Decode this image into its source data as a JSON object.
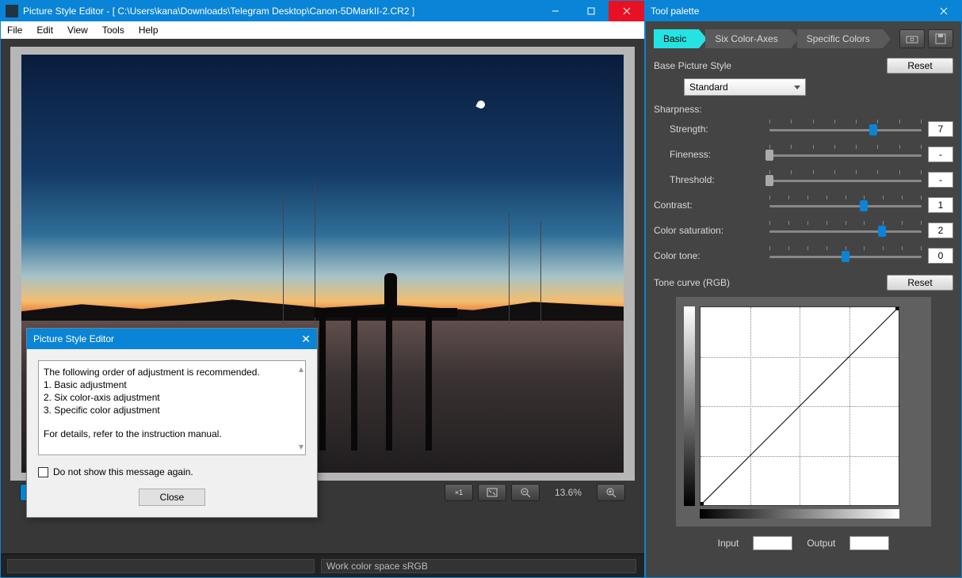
{
  "main": {
    "title": "Picture Style Editor - [ C:\\Users\\kana\\Downloads\\Telegram Desktop\\Canon-5DMarkII-2.CR2 ]",
    "menu": {
      "file": "File",
      "edit": "Edit",
      "view": "View",
      "tools": "Tools",
      "help": "Help"
    },
    "zoom": "13.6%",
    "status": "Work color space  sRGB"
  },
  "dialog": {
    "title": "Picture Style Editor",
    "l1": "The following order of adjustment is recommended.",
    "l2": "1. Basic adjustment",
    "l3": "2. Six color-axis adjustment",
    "l4": "3. Specific color adjustment",
    "l5": "For details, refer to the instruction manual.",
    "chk": "Do not show this message again.",
    "close": "Close"
  },
  "side": {
    "title": "Tool palette",
    "tabs": {
      "basic": "Basic",
      "six": "Six Color-Axes",
      "spec": "Specific Colors"
    },
    "base_label": "Base Picture Style",
    "reset": "Reset",
    "base_value": "Standard",
    "sharp": "Sharpness:",
    "strength": "Strength:",
    "strength_v": "7",
    "fineness": "Fineness:",
    "fineness_v": "-",
    "threshold": "Threshold:",
    "threshold_v": "-",
    "contrast": "Contrast:",
    "contrast_v": "1",
    "sat": "Color saturation:",
    "sat_v": "2",
    "tone": "Color tone:",
    "tone_v": "0",
    "tc": "Tone curve (RGB)",
    "input": "Input",
    "output": "Output"
  }
}
